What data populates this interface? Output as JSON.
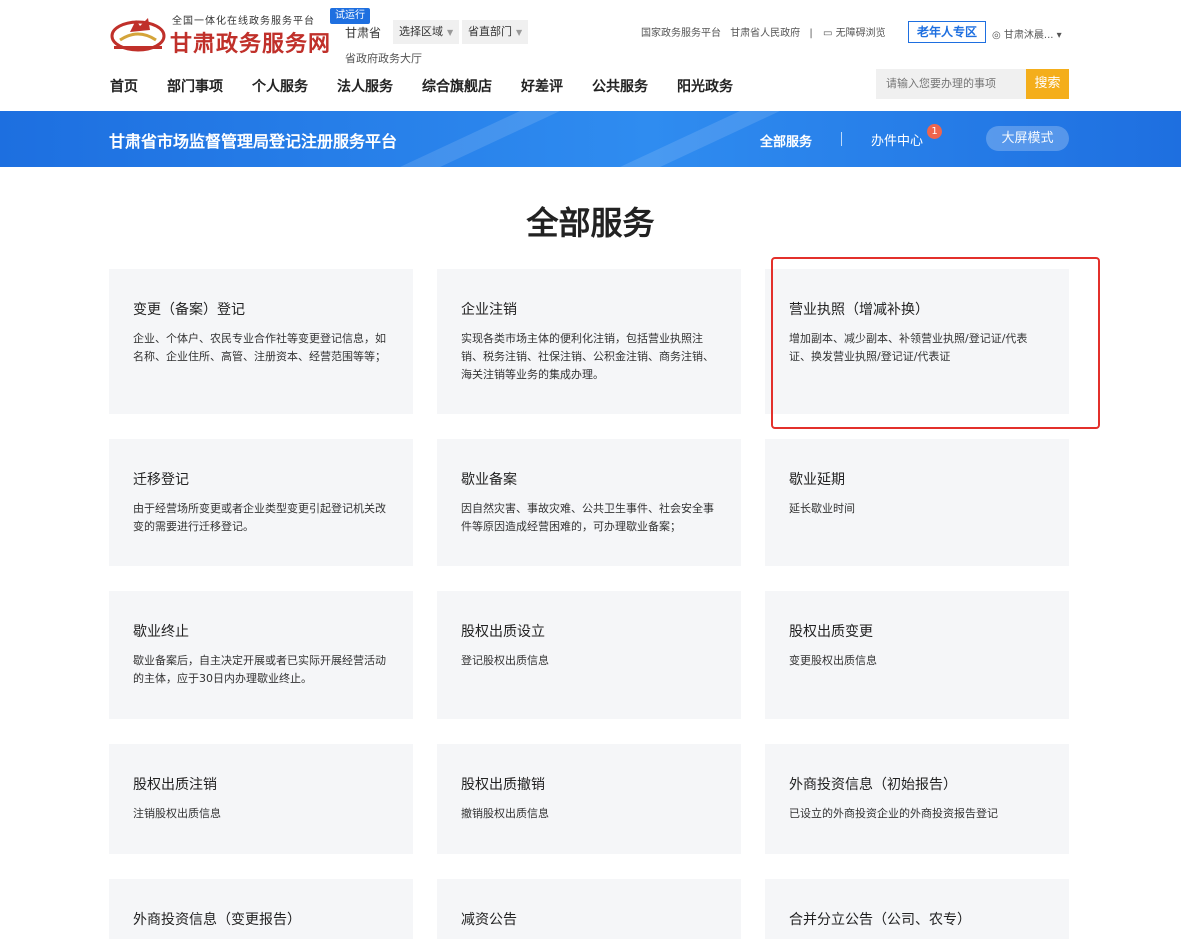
{
  "header": {
    "slogan": "全国一体化在线政务服务平台",
    "site_title": "甘肃政务服务网",
    "trial_badge": "试运行",
    "province": "甘肃省",
    "region_select": "选择区域",
    "dept_select": "省直部门",
    "hall_link": "省政府政务大厅",
    "top_links": [
      "国家政务服务平台",
      "甘肃省人民政府"
    ],
    "separator": "|",
    "a11y": "无障碍浏览",
    "elder_zone": "老年人专区",
    "user": "甘肃沐晨..."
  },
  "nav": {
    "items": [
      "首页",
      "部门事项",
      "个人服务",
      "法人服务",
      "综合旗舰店",
      "好差评",
      "公共服务",
      "阳光政务"
    ],
    "search_placeholder": "请输入您要办理的事项",
    "search_button": "搜索"
  },
  "banner": {
    "title": "甘肃省市场监督管理局登记注册服务平台",
    "all_services": "全部服务",
    "office_center": "办件中心",
    "office_badge": "1",
    "big_screen": "大屏模式"
  },
  "main": {
    "title": "全部服务",
    "cards": [
      {
        "title": "变更（备案）登记",
        "desc": "企业、个体户、农民专业合作社等变更登记信息，如名称、企业住所、高管、注册资本、经营范围等等；"
      },
      {
        "title": "企业注销",
        "desc": "实现各类市场主体的便利化注销，包括营业执照注销、税务注销、社保注销、公积金注销、商务注销、海关注销等业务的集成办理。"
      },
      {
        "title": "营业执照（增减补换）",
        "desc": "增加副本、减少副本、补领营业执照/登记证/代表证、换发营业执照/登记证/代表证"
      },
      {
        "title": "迁移登记",
        "desc": "由于经营场所变更或者企业类型变更引起登记机关改变的需要进行迁移登记。"
      },
      {
        "title": "歇业备案",
        "desc": "因自然灾害、事故灾难、公共卫生事件、社会安全事件等原因造成经营困难的，可办理歇业备案；"
      },
      {
        "title": "歇业延期",
        "desc": "延长歇业时间"
      },
      {
        "title": "歇业终止",
        "desc": "歇业备案后，自主决定开展或者已实际开展经营活动的主体，应于30日内办理歇业终止。"
      },
      {
        "title": "股权出质设立",
        "desc": "登记股权出质信息"
      },
      {
        "title": "股权出质变更",
        "desc": "变更股权出质信息"
      },
      {
        "title": "股权出质注销",
        "desc": "注销股权出质信息"
      },
      {
        "title": "股权出质撤销",
        "desc": "撤销股权出质信息"
      },
      {
        "title": "外商投资信息（初始报告）",
        "desc": "已设立的外商投资企业的外商投资报告登记"
      },
      {
        "title": "外商投资信息（变更报告）",
        "desc": ""
      },
      {
        "title": "减资公告",
        "desc": ""
      },
      {
        "title": "合并分立公告（公司、农专）",
        "desc": ""
      }
    ]
  },
  "colors": {
    "brand_red": "#c0302a",
    "primary_blue": "#1e6fe0",
    "search_orange": "#f4ae1b",
    "highlight_red": "#e3302b",
    "card_bg": "#f5f6f8"
  }
}
